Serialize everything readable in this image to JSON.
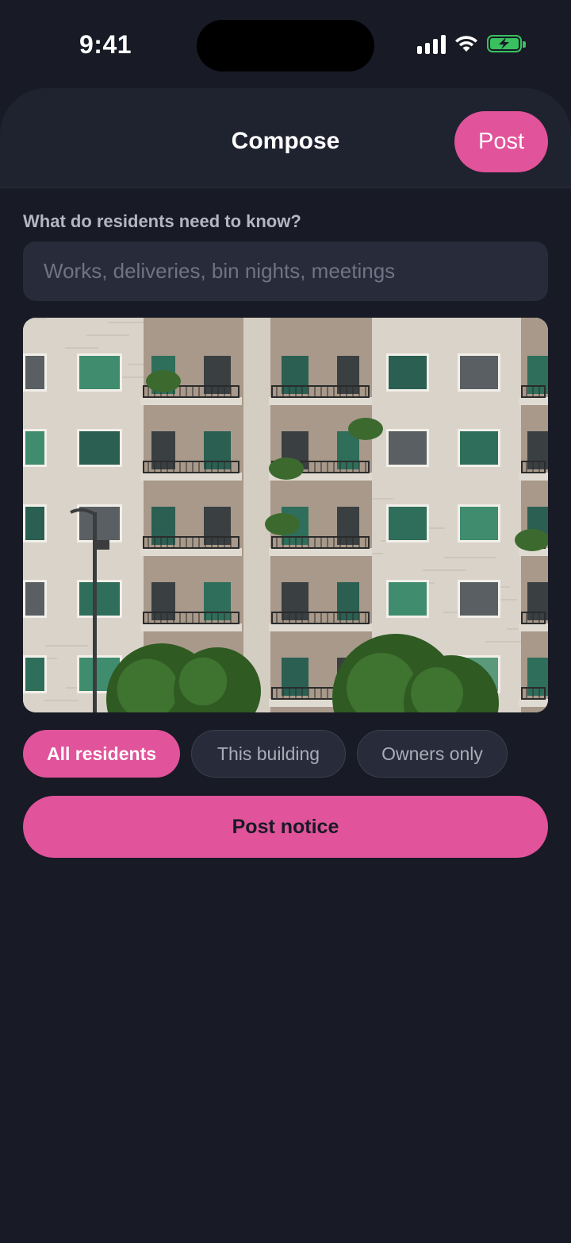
{
  "status_bar": {
    "time": "9:41",
    "icons": [
      "signal-icon",
      "wifi-icon",
      "battery-charging-icon"
    ],
    "battery_color": "#39c160"
  },
  "header": {
    "title": "Compose",
    "post_label": "Post"
  },
  "composer": {
    "prompt": "What do residents need to know?",
    "input_value": "",
    "input_placeholder": "Works, deliveries, bin nights, meetings",
    "attachment": "apartment-building-photo"
  },
  "audience": {
    "options": [
      {
        "label": "All residents",
        "selected": true
      },
      {
        "label": "This building",
        "selected": false
      },
      {
        "label": "Owners only",
        "selected": false
      }
    ]
  },
  "actions": {
    "submit_label": "Post notice"
  },
  "colors": {
    "accent": "#e1539a",
    "background": "#181a25",
    "surface": "#282b39",
    "header": "#1f222f"
  }
}
